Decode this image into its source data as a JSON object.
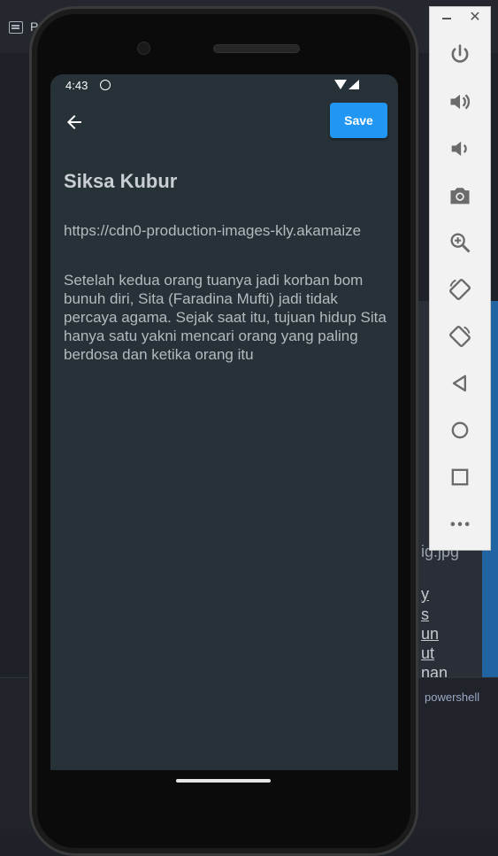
{
  "ide": {
    "partial_title": "P",
    "right_panel_lines": [
      "ig.jpg",
      "y",
      "s",
      "un",
      "ut",
      "nan"
    ],
    "terminal_tab": "powershell"
  },
  "device": {
    "status_bar": {
      "time": "4:43"
    }
  },
  "app": {
    "toolbar": {
      "save_label": "Save"
    },
    "article": {
      "title": "Siksa Kubur",
      "url": "https://cdn0-production-images-kly.akamaize",
      "description": "Setelah kedua orang tuanya jadi korban bom bunuh diri, Sita (Faradina Mufti) jadi tidak percaya agama. Sejak saat itu, tujuan hidup Sita hanya satu yakni mencari orang yang paling berdosa dan ketika orang itu"
    }
  },
  "emulator_toolbar": {
    "close_glyph": "✕",
    "buttons": [
      "power-icon",
      "volume-up-icon",
      "volume-down-icon",
      "camera-icon",
      "zoom-icon",
      "rotate-left-icon",
      "rotate-right-icon",
      "back-triangle-icon",
      "home-circle-icon",
      "overview-square-icon",
      "more-icon"
    ]
  }
}
